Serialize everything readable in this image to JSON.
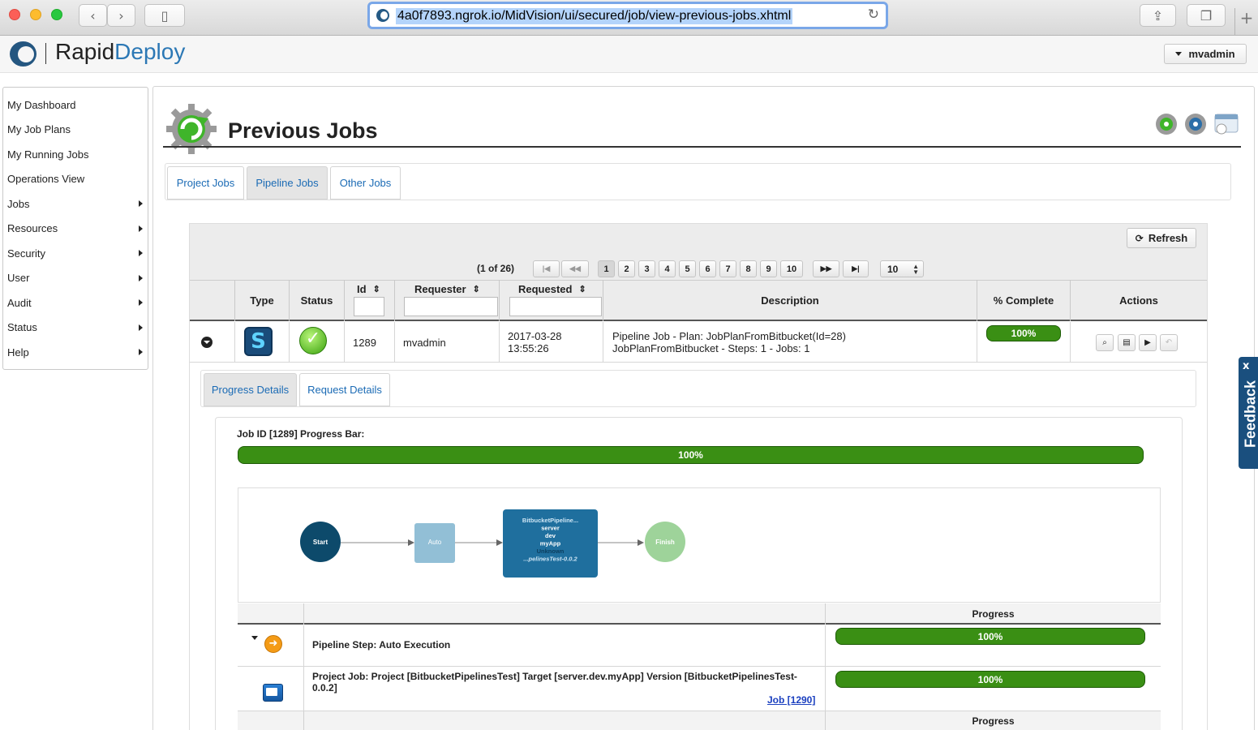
{
  "browser": {
    "url": "4a0f7893.ngrok.io/MidVision/ui/secured/job/view-previous-jobs.xhtml",
    "back_glyph": "‹",
    "forward_glyph": "›",
    "sidebar_glyph": "▯",
    "share_glyph": "⇪",
    "tabs_glyph": "❐",
    "reload_glyph": "↻",
    "newtab_glyph": "+"
  },
  "app": {
    "brand_prefix": "Rapid",
    "brand_suffix": "Deploy",
    "user": "mvadmin"
  },
  "sidebar": {
    "items": [
      {
        "label": "My Dashboard",
        "submenu": false
      },
      {
        "label": "My Job Plans",
        "submenu": false
      },
      {
        "label": "My Running Jobs",
        "submenu": false
      },
      {
        "label": "Operations View",
        "submenu": false
      },
      {
        "label": "Jobs",
        "submenu": true
      },
      {
        "label": "Resources",
        "submenu": true
      },
      {
        "label": "Security",
        "submenu": true
      },
      {
        "label": "User",
        "submenu": true
      },
      {
        "label": "Audit",
        "submenu": true
      },
      {
        "label": "Status",
        "submenu": true
      },
      {
        "label": "Help",
        "submenu": true
      }
    ]
  },
  "page": {
    "title": "Previous Jobs",
    "tabs": [
      {
        "label": "Project Jobs",
        "active": false
      },
      {
        "label": "Pipeline Jobs",
        "active": true
      },
      {
        "label": "Other Jobs",
        "active": false
      }
    ],
    "title_icons": [
      "gear-green-icon",
      "gear-blue-icon",
      "calendar-icon"
    ]
  },
  "table": {
    "refresh_label": "Refresh",
    "pager": {
      "info": "(1 of 26)",
      "first": "|◀",
      "prev": "◀◀",
      "pages": [
        "1",
        "2",
        "3",
        "4",
        "5",
        "6",
        "7",
        "8",
        "9",
        "10"
      ],
      "current_page": 1,
      "next": "▶▶",
      "last": "▶|",
      "page_size": "10"
    },
    "columns": {
      "type": "Type",
      "status": "Status",
      "id": "Id",
      "requester": "Requester",
      "requested": "Requested",
      "description": "Description",
      "complete": "% Complete",
      "actions": "Actions"
    },
    "sort_glyph": "⇕",
    "row": {
      "type_icon": "pipeline-type-icon",
      "status_icon": "success-check-icon",
      "id": "1289",
      "requester": "mvadmin",
      "requested_date": "2017-03-28",
      "requested_time": "13:55:26",
      "description": "Pipeline Job - Plan: JobPlanFromBitbucket(Id=28) JobPlanFromBitbucket - Steps: 1 - Jobs: 1",
      "complete": 1.0,
      "complete_label": "100%",
      "actions": [
        {
          "icon": "magnify-icon",
          "glyph": "⌕",
          "enabled": true
        },
        {
          "icon": "document-icon",
          "glyph": "▤",
          "enabled": true
        },
        {
          "icon": "play-icon",
          "glyph": "▶",
          "enabled": true
        },
        {
          "icon": "undo-icon",
          "glyph": "↶",
          "enabled": false
        }
      ]
    }
  },
  "details": {
    "tabs": [
      {
        "label": "Progress Details",
        "active": true
      },
      {
        "label": "Request Details",
        "active": false
      }
    ],
    "progress_label": "Job ID [1289] Progress Bar:",
    "progress": 1.0,
    "progress_text": "100%",
    "flow": {
      "start": "Start",
      "auto": "Auto",
      "box_lines": [
        "BitbucketPipeline...",
        "server",
        "dev",
        "myApp",
        "Unknown",
        "...pelinesTest-0.0.2"
      ],
      "finish": "Finish"
    },
    "steps_header": "Progress",
    "steps": [
      {
        "icon": "auto-step-icon",
        "text": "Pipeline Step: Auto Execution",
        "progress": 1.0,
        "progress_text": "100%"
      },
      {
        "icon": "project-job-icon",
        "text": "Project Job: Project [BitbucketPipelinesTest] Target [server.dev.myApp] Version [BitbucketPipelinesTest-0.0.2]",
        "link": "Job [1290]",
        "progress": 1.0,
        "progress_text": "100%"
      }
    ],
    "steps_header_2": "Progress"
  },
  "feedback": {
    "label": "Feedback",
    "close": "x"
  },
  "colors": {
    "accent_blue": "#2c78b5",
    "progress_green": "#2e7d0e",
    "flow_start": "#0d4a6b",
    "flow_auto": "#92bfd6",
    "flow_box": "#1f6f9e",
    "flow_finish": "#9ed39a"
  }
}
